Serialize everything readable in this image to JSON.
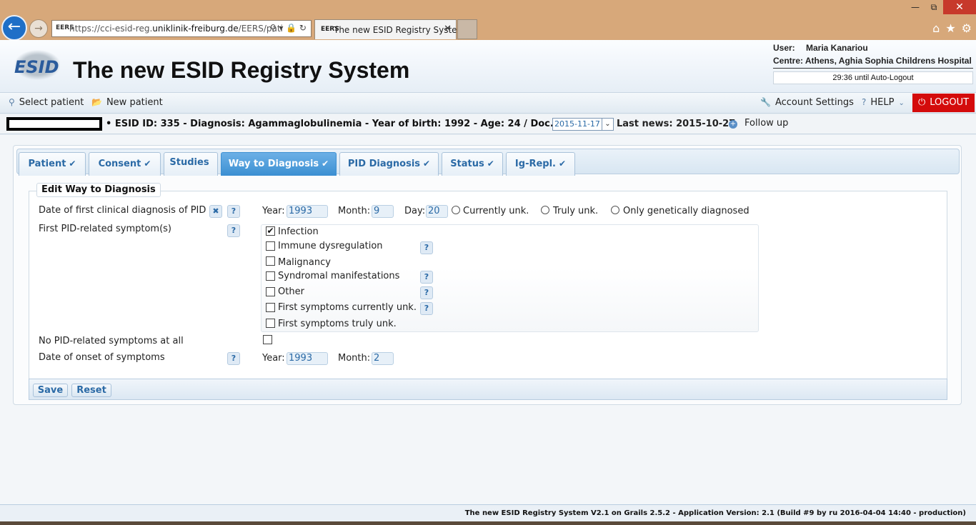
{
  "browser": {
    "url_prefix": "https://cci-esid-reg.",
    "url_domain": "uniklinik-freiburg.de",
    "url_suffix": "/EERS/pati",
    "tab_title": "The new ESID Registry Syste...",
    "favicon": "EERS"
  },
  "header": {
    "logo_text": "ESID",
    "title": "The new ESID Registry System",
    "user_label": "User:",
    "user_name": "Maria Kanariou",
    "centre": "Centre: Athens, Aghia Sophia Childrens Hospital",
    "autologout": "29:36 until Auto-Logout"
  },
  "nav": {
    "select_patient": "Select patient",
    "new_patient": "New patient",
    "account_settings": "Account Settings",
    "help": "HELP",
    "logout": "LOGOUT"
  },
  "patient": {
    "info": "• ESID ID: 335 - Diagnosis: Agammaglobulinemia - Year of birth: 1992 - Age: 24  /  Doc. date:",
    "doc_date": "2015-11-17",
    "last_news": "Last news: 2015-10-27",
    "follow_up": "Follow up"
  },
  "tabs": [
    {
      "label": "Patient",
      "check": "✔"
    },
    {
      "label": "Consent",
      "check": "✔"
    },
    {
      "label": "Studies",
      "check": ""
    },
    {
      "label": "Way to Diagnosis",
      "check": "✔"
    },
    {
      "label": "PID Diagnosis",
      "check": "✔"
    },
    {
      "label": "Status",
      "check": "✔"
    },
    {
      "label": "Ig-Repl.",
      "check": "✔"
    }
  ],
  "form": {
    "legend": "Edit Way to Diagnosis",
    "first_diagnosis_label": "Date of first clinical diagnosis of PID",
    "year_label": "Year:",
    "year_value": "1993",
    "month_label": "Month:",
    "month_value": "9",
    "day_label": "Day:",
    "day_value": "20",
    "opt_currently": "Currently unk.",
    "opt_truly": "Truly unk.",
    "opt_genetic": "Only genetically diagnosed",
    "symptoms_label": "First PID-related symptom(s)",
    "symptoms": [
      {
        "label": "Infection",
        "checked": "✔"
      },
      {
        "label": "Immune dysregulation",
        "checked": ""
      },
      {
        "label": "Malignancy",
        "checked": ""
      },
      {
        "label": "Syndromal manifestations",
        "checked": ""
      },
      {
        "label": "Other",
        "checked": ""
      },
      {
        "label": "First symptoms currently unk.",
        "checked": ""
      },
      {
        "label": "First symptoms truly unk.",
        "checked": ""
      }
    ],
    "no_symptoms_label": "No PID-related symptoms at all",
    "onset_label": "Date of onset of symptoms",
    "onset_year_label": "Year:",
    "onset_year_value": "1993",
    "onset_month_label": "Month:",
    "onset_month_value": "2",
    "help_mark": "?",
    "clear_mark": "✖"
  },
  "actions": {
    "save": "Save",
    "reset": "Reset"
  },
  "footer": {
    "text": "The new ESID Registry System V2.1 on Grails 2.5.2 - Application Version: 2.1 (Build #9 by ru 2016-04-04 14:40 - production)"
  }
}
